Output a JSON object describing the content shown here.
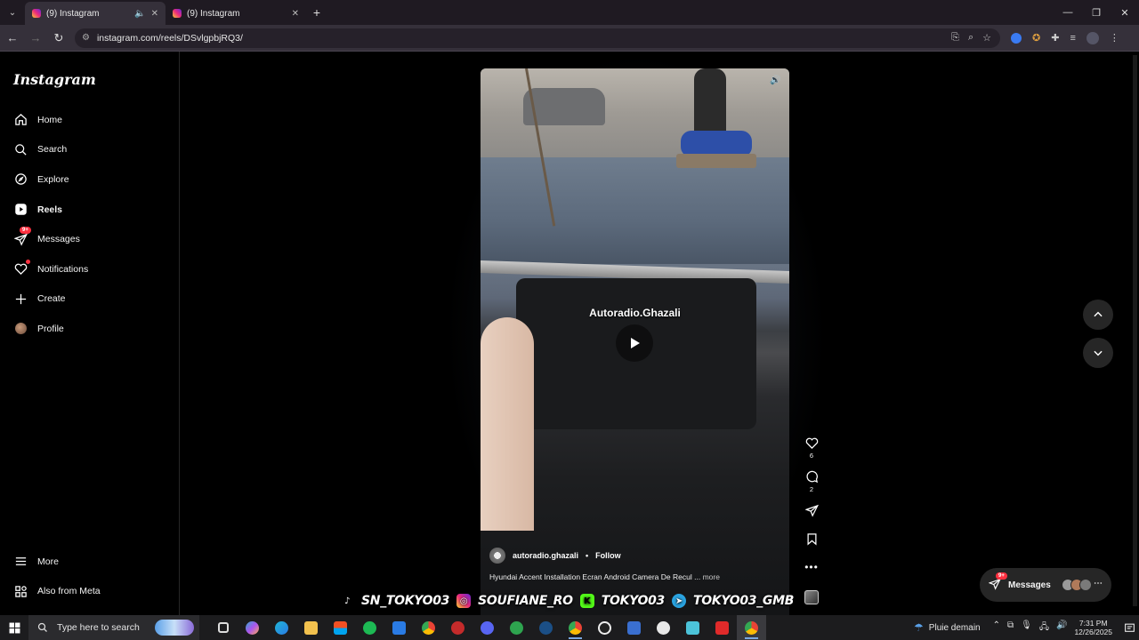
{
  "browser": {
    "tabs": [
      {
        "title": "(9) Instagram",
        "audio_icon": "speaker-icon"
      },
      {
        "title": "(9) Instagram"
      }
    ],
    "url": "instagram.com/reels/DSvlgpbjRQ3/"
  },
  "instagram": {
    "logo": "Instagram",
    "nav": [
      {
        "label": "Home",
        "icon": "home-icon"
      },
      {
        "label": "Search",
        "icon": "search-icon"
      },
      {
        "label": "Explore",
        "icon": "compass-icon"
      },
      {
        "label": "Reels",
        "icon": "reels-icon",
        "active": true
      },
      {
        "label": "Messages",
        "icon": "messenger-icon",
        "badge": "9+"
      },
      {
        "label": "Notifications",
        "icon": "heart-icon"
      },
      {
        "label": "Create",
        "icon": "plus-icon"
      },
      {
        "label": "Profile",
        "icon": "avatar"
      }
    ],
    "bottom_nav": [
      {
        "label": "More",
        "icon": "hamburger-icon"
      },
      {
        "label": "Also from Meta",
        "icon": "meta-icon"
      }
    ],
    "reel": {
      "overlay_text": "Autoradio.Ghazali",
      "author": "autoradio.ghazali",
      "follow_label": "Follow",
      "caption": "Hyundai Accent Installation Ecran Android Camera De Recul ...",
      "more_label": "more",
      "likes": "6",
      "comments": "2"
    },
    "messages_pill": {
      "label": "Messages",
      "badge": "9+"
    },
    "stream_overlay": [
      "SN_TOKYO03",
      "SOUFIANE_RO",
      "TOKYO03",
      "TOKYO03_GMB"
    ]
  },
  "taskbar": {
    "search_placeholder": "Type here to search",
    "weather": "Pluie demain",
    "time": "7:31 PM",
    "date": "12/26/2025"
  },
  "colors": {
    "accent_badge": "#ff3040",
    "active_tab": "#35303a",
    "taskbar": "#1c1c1e"
  }
}
